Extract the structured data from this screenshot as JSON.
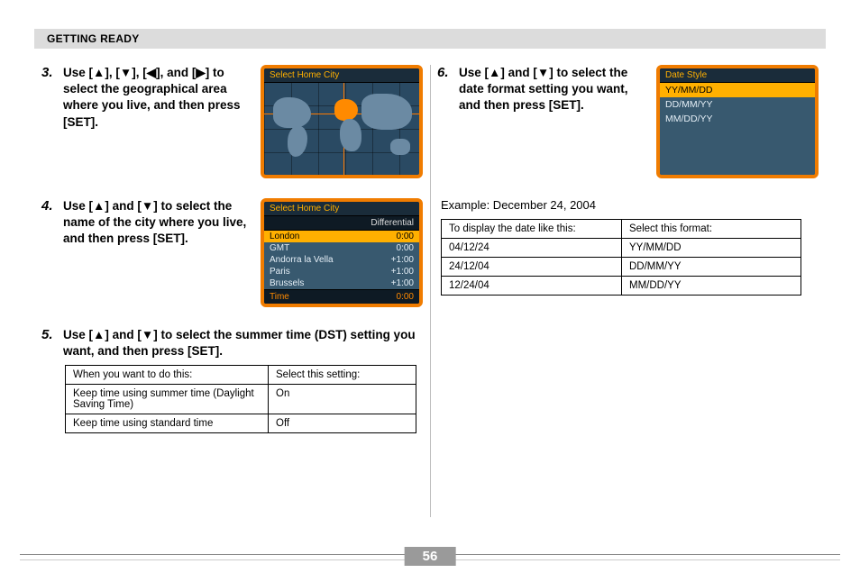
{
  "header": "GETTING READY",
  "page_number": "56",
  "steps": {
    "s3": {
      "num": "3.",
      "text_a": "Use [",
      "text_b": "], [",
      "text_c": "], [",
      "text_d": "], and [",
      "text_e": "] to select the geographical area where you live, and then press [SET]."
    },
    "s4": {
      "num": "4.",
      "text_a": "Use [",
      "text_b": "] and [",
      "text_c": "] to select the name of the city where you live, and then press [SET]."
    },
    "s5": {
      "num": "5.",
      "text_a": "Use [",
      "text_b": "] and [",
      "text_c": "] to select the summer time (DST) setting you want, and then press [SET]."
    },
    "s6": {
      "num": "6.",
      "text_a": "Use [",
      "text_b": "] and [",
      "text_c": "] to select the date format setting you want, and then press [SET]."
    }
  },
  "device_map": {
    "title": "Select Home City"
  },
  "device_city": {
    "title": "Select Home City",
    "diff_label": "Differential",
    "rows": [
      {
        "name": "London",
        "offset": "0:00",
        "selected": true
      },
      {
        "name": "GMT",
        "offset": "0:00",
        "selected": false
      },
      {
        "name": "Andorra la Vella",
        "offset": "+1:00",
        "selected": false
      },
      {
        "name": "Paris",
        "offset": "+1:00",
        "selected": false
      },
      {
        "name": "Brussels",
        "offset": "+1:00",
        "selected": false
      }
    ],
    "foot_label": "Time",
    "foot_value": "0:00"
  },
  "device_date": {
    "title": "Date Style",
    "rows": [
      {
        "label": "YY/MM/DD",
        "selected": true
      },
      {
        "label": "DD/MM/YY",
        "selected": false
      },
      {
        "label": "MM/DD/YY",
        "selected": false
      }
    ]
  },
  "dst_table": {
    "h1": "When you want to do this:",
    "h2": "Select this setting:",
    "rows": [
      {
        "c1": "Keep time using summer time (Daylight Saving Time)",
        "c2": "On"
      },
      {
        "c1": "Keep time using standard time",
        "c2": "Off"
      }
    ]
  },
  "example_label": "Example: December 24, 2004",
  "fmt_table": {
    "h1": "To display the date like this:",
    "h2": "Select this format:",
    "rows": [
      {
        "c1": "04/12/24",
        "c2": "YY/MM/DD"
      },
      {
        "c1": "24/12/04",
        "c2": "DD/MM/YY"
      },
      {
        "c1": "12/24/04",
        "c2": "MM/DD/YY"
      }
    ]
  }
}
